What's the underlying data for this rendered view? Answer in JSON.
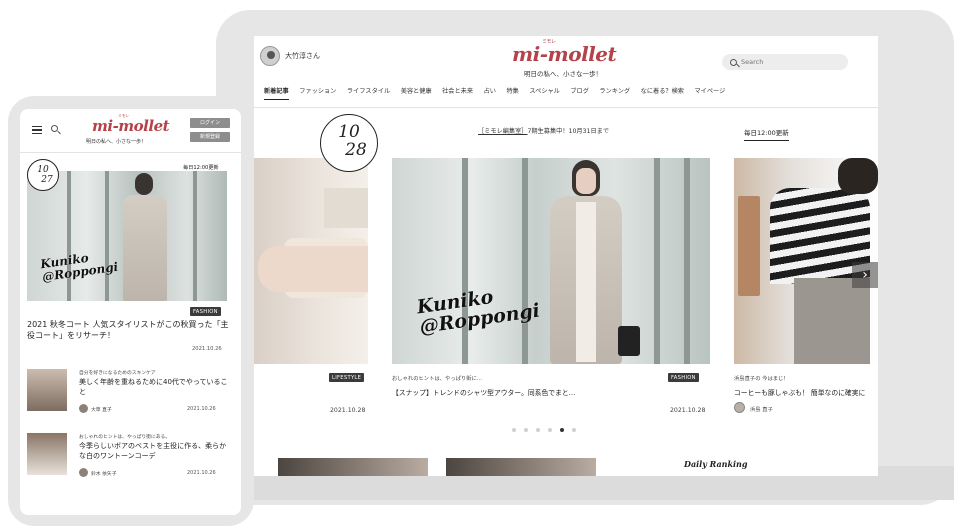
{
  "tablet": {
    "user_name": "大竹淳さん",
    "logo": "mi-mollet",
    "logo_ruby": "ミモレ",
    "tagline": "明日の私へ、小さな一歩！",
    "search_placeholder": "Search",
    "nav": [
      "新着記事",
      "ファッション",
      "ライフスタイル",
      "美容と健康",
      "社会と未来",
      "占い",
      "特集",
      "スペシャル",
      "ブログ",
      "ランキング",
      "なに着る？検索",
      "マイページ"
    ],
    "date_badge": {
      "month": "10",
      "day": "28"
    },
    "notice_link": "［ミモレ編集室］",
    "notice_text": "7期生募集中！10月31日まで",
    "daily_update": "毎日12:00更新",
    "slides": [
      {
        "tag": "LIFESTYLE",
        "date": "2021.10.28"
      },
      {
        "image_text_line1": "Kuniko",
        "image_text_line2": "@Roppongi",
        "subtitle": "おしゃれのヒントは、やっぱり街に…",
        "title": "【スナップ】トレンドのシャツ型アウター。同系色でまと…",
        "tag": "FASHION",
        "date": "2021.10.28"
      },
      {
        "subtitle": "浜島直子の 今はまじ！",
        "title": "コーヒーも豚しゃぶも！ 簡単なのに確実に",
        "author": "浜島 直子"
      }
    ],
    "next_icon": "›",
    "carousel_active_index": 4,
    "carousel_count": 6,
    "ranking_title": "Daily Ranking"
  },
  "phone": {
    "logo": "mi-mollet",
    "logo_ruby": "ミモレ",
    "tagline": "明日の私へ、小さな一歩！",
    "login_label": "ログイン",
    "register_label": "新規登録",
    "date_badge": {
      "month": "10",
      "day": "27"
    },
    "daily_update": "毎日12:00更新",
    "hero_text_line1": "Kuniko",
    "hero_text_line2": "@Roppongi",
    "hero_tag": "FASHION",
    "headline": "2021 秋冬コート 人気スタイリストがこの秋買った「主役コート」をリサーチ！",
    "headline_date": "2021.10.26",
    "articles": [
      {
        "subtitle": "自分を好きになるためのスキンケア",
        "title": "美しく年齢を重ねるために40代でやっていること",
        "author": "大草 直子",
        "date": "2021.10.26"
      },
      {
        "subtitle": "おしゃれのヒントは、やっぱり街にある。",
        "title": "今季らしいボアのベストを主役に作る、柔らかな白のワントーンコーデ",
        "author": "鈴木 依矢子",
        "date": "2021.10.26"
      }
    ]
  }
}
